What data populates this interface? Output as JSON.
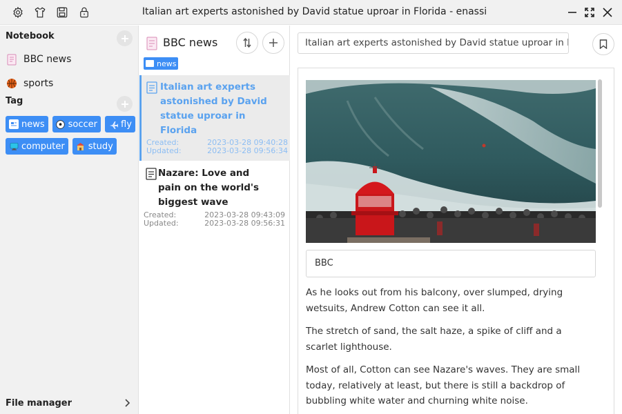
{
  "window": {
    "title": "Italian art experts astonished by David statue uproar in Florida - enassi"
  },
  "sidebar": {
    "notebook_heading": "Notebook",
    "notebooks": [
      {
        "label": "BBC news",
        "icon": "notebook-icon"
      },
      {
        "label": "sports",
        "icon": "basketball-icon"
      }
    ],
    "tag_heading": "Tag",
    "tags": [
      {
        "label": "news",
        "icon": "newspaper-icon"
      },
      {
        "label": "soccer",
        "icon": "soccer-ball-icon"
      },
      {
        "label": "fly",
        "icon": "airplane-icon"
      },
      {
        "label": "computer",
        "icon": "monitor-icon"
      },
      {
        "label": "study",
        "icon": "school-icon"
      }
    ],
    "file_manager_label": "File manager"
  },
  "note_list": {
    "notebook_title": "BBC news",
    "filter_tag": "news",
    "notes": [
      {
        "title": "Italian art experts astonished by David statue uproar in Florida",
        "created_label": "Created:",
        "created": "2023-03-28 09:40:28",
        "updated_label": "Updated:",
        "updated": "2023-03-28 09:56:34"
      },
      {
        "title": "Nazare: Love and pain on the world's biggest wave",
        "created_label": "Created:",
        "created": "2023-03-28 09:43:09",
        "updated_label": "Updated:",
        "updated": "2023-03-28 09:56:31"
      }
    ]
  },
  "editor": {
    "title_value": "Italian art experts astonished by David statue uproar in Florida",
    "caption": "BBC",
    "paragraphs": [
      "As he looks out from his balcony, over slumped, drying wetsuits, Andrew Cotton can see it all.",
      "The stretch of sand, the salt haze, a spike of cliff and a scarlet lighthouse.",
      "Most of all, Cotton can see Nazare's waves. They are small today, relatively at least, but there is still a backdrop of bubbling white water and churning white noise."
    ]
  },
  "colors": {
    "accent": "#3d8ef5",
    "active_title": "#5aa2ef",
    "sidebar_bg": "#f1f1f1"
  }
}
